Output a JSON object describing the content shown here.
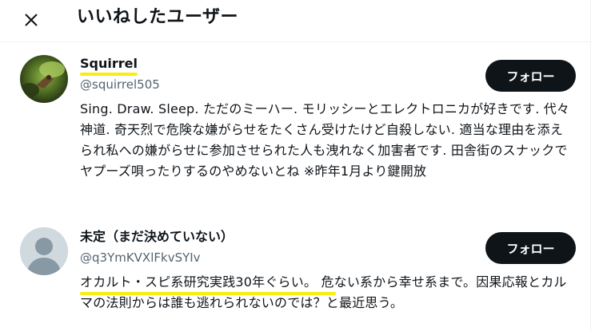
{
  "header": {
    "close_icon": "close-icon",
    "title": "いいねしたユーザー"
  },
  "highlight_color": "#f7ee16",
  "users": [
    {
      "name": "Squirrel",
      "handle": "@squirrel505",
      "follow_label": "フォロー",
      "bio": "Sing. Draw. Sleep. ただのミーハー. モリッシーとエレクトロニカが好きです. 代々神道. 奇天烈で危険な嫌がらせをたくさん受けたけど自殺しない. 適当な理由を添えられ私への嫌がらせに参加させられた人も洩れなく加害者です. 田舎街のスナックでヤプーズ唄ったりするのやめないとね ※昨年1月より鍵開放"
    },
    {
      "name": "未定（まだ決めていない）",
      "handle": "@q3YmKVXlFkvSYIv",
      "follow_label": "フォロー",
      "bio": "オカルト・スピ系研究実践30年ぐらい。 危ない系から幸せ系まで。因果応報とカルマの法則からは誰も逃れられないのでは？と最近思う。"
    }
  ]
}
